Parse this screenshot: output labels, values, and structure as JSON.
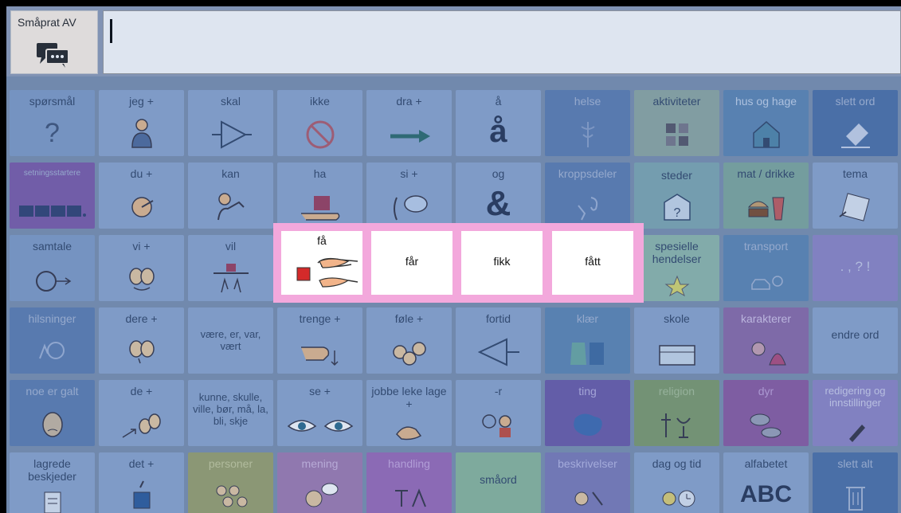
{
  "topbar": {
    "speak_button_label": "Småprat AV",
    "message_text": ""
  },
  "cells": [
    [
      "spørsmål",
      "jeg +",
      "skal",
      "ikke",
      "dra +",
      "å",
      "helse",
      "aktiviteter",
      "hus og hage",
      "slett ord"
    ],
    [
      "setningsstartere",
      "du +",
      "kan",
      "ha",
      "si +",
      "og",
      "kroppsdeler",
      "steder",
      "mat / drikke",
      "tema"
    ],
    [
      "samtale",
      "vi +",
      "vil",
      "",
      "",
      "",
      "",
      "spesielle hendelser",
      "transport",
      ". , ? !"
    ],
    [
      "hilsninger",
      "dere +",
      "være, er, var, vært",
      "trenge +",
      "føle +",
      "fortid",
      "klær",
      "skole",
      "karakterer",
      "endre ord"
    ],
    [
      "noe er galt",
      "de +",
      "kunne, skulle, ville, bør, må, la, bli, skje",
      "se +",
      "jobbe leke lage +",
      "-r",
      "ting",
      "religion",
      "dyr",
      "redigering og innstillinger"
    ],
    [
      "lagrede beskjeder",
      "det +",
      "personer",
      "mening",
      "handling",
      "småord",
      "beskrivelser",
      "dag og tid",
      "alfabetet",
      "slett alt"
    ]
  ],
  "glyphs": {
    "question": "?",
    "aa": "å",
    "and": "&",
    "abc": "ABC",
    "punct": ". , ? !"
  },
  "popup": {
    "items": [
      "få",
      "får",
      "fikk",
      "fått"
    ]
  },
  "colors": {
    "popup_border": "#f3a8dc",
    "speak_bg": "#fff3e6"
  }
}
